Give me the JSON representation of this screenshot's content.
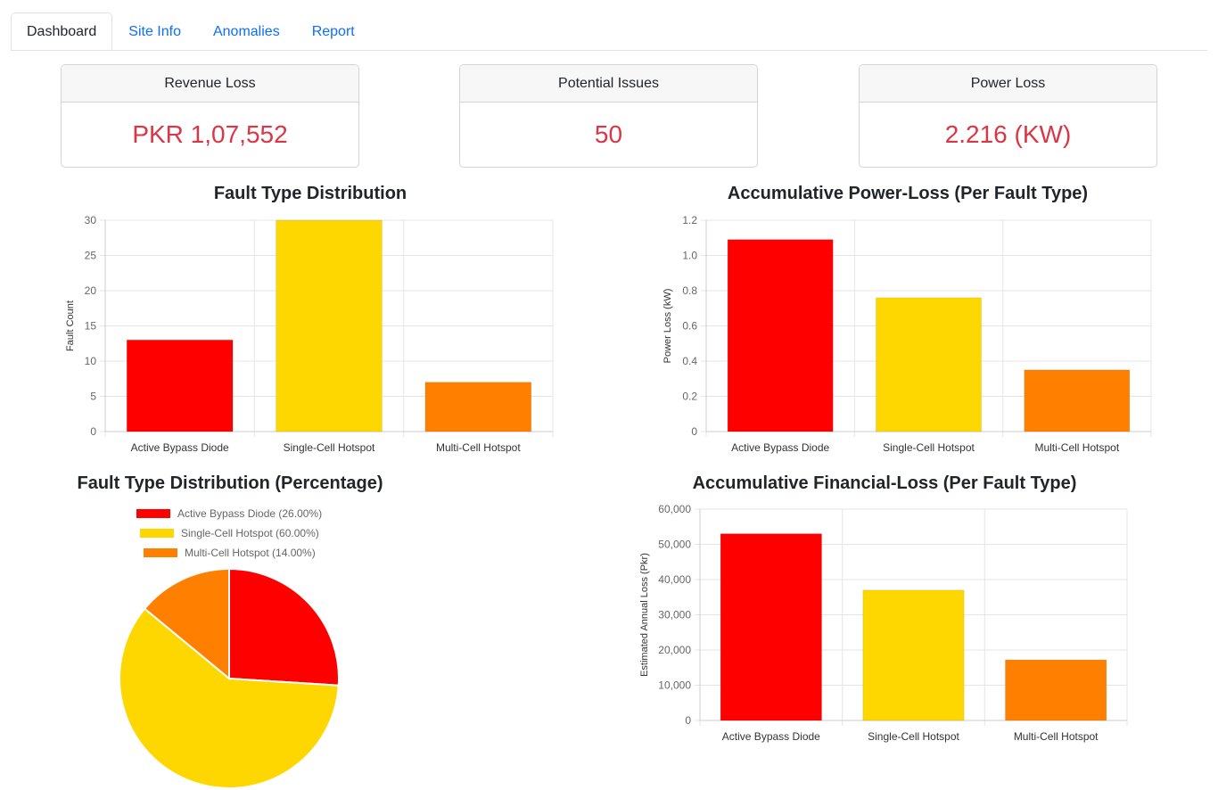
{
  "tabs": [
    {
      "label": "Dashboard",
      "active": true
    },
    {
      "label": "Site Info",
      "active": false
    },
    {
      "label": "Anomalies",
      "active": false
    },
    {
      "label": "Report",
      "active": false
    }
  ],
  "cards": {
    "revenue_loss": {
      "title": "Revenue Loss",
      "value": "PKR 1,07,552"
    },
    "potential_issues": {
      "title": "Potential Issues",
      "value": "50"
    },
    "power_loss": {
      "title": "Power Loss",
      "value": "2.216 (KW)"
    }
  },
  "colors": {
    "red": "#ff0000",
    "yellow": "#ffd700",
    "orange": "#ff8000",
    "value_text": "#dc3545",
    "link": "#0d6efd"
  },
  "chart_data": [
    {
      "id": "fault-type-distribution",
      "type": "bar",
      "title": "Fault Type Distribution",
      "ylabel": "Fault Count",
      "categories": [
        "Active Bypass Diode",
        "Single-Cell Hotspot",
        "Multi-Cell Hotspot"
      ],
      "values": [
        13,
        30,
        7
      ],
      "colors": [
        "#ff0000",
        "#ffd700",
        "#ff8000"
      ],
      "ylim": [
        0,
        30
      ],
      "yticks": [
        "0",
        "5",
        "10",
        "15",
        "20",
        "25",
        "30"
      ],
      "grid": true
    },
    {
      "id": "accumulative-power-loss",
      "type": "bar",
      "title": "Accumulative Power-Loss (Per Fault Type)",
      "ylabel": "Power Loss (kW)",
      "categories": [
        "Active Bypass Diode",
        "Single-Cell Hotspot",
        "Multi-Cell Hotspot"
      ],
      "values": [
        1.09,
        0.76,
        0.35
      ],
      "colors": [
        "#ff0000",
        "#ffd700",
        "#ff8000"
      ],
      "ylim": [
        0,
        1.2
      ],
      "yticks": [
        "0",
        "0.2",
        "0.4",
        "0.6",
        "0.8",
        "1.0",
        "1.2"
      ],
      "grid": true
    },
    {
      "id": "fault-type-percentage",
      "type": "pie",
      "title": "Fault Type Distribution (Percentage)",
      "labels": [
        "Active Bypass Diode (26.00%)",
        "Single-Cell Hotspot (60.00%)",
        "Multi-Cell Hotspot (14.00%)"
      ],
      "values": [
        26,
        60,
        14
      ],
      "colors": [
        "#ff0000",
        "#ffd700",
        "#ff8000"
      ],
      "legend": "top"
    },
    {
      "id": "accumulative-financial-loss",
      "type": "bar",
      "title": "Accumulative Financial-Loss (Per Fault Type)",
      "ylabel": "Estimated Annual Loss (Pkr)",
      "categories": [
        "Active Bypass Diode",
        "Single-Cell Hotspot",
        "Multi-Cell Hotspot"
      ],
      "values": [
        53000,
        37000,
        17200
      ],
      "colors": [
        "#ff0000",
        "#ffd700",
        "#ff8000"
      ],
      "ylim": [
        0,
        60000
      ],
      "yticks": [
        "0",
        "10,000",
        "20,000",
        "30,000",
        "40,000",
        "50,000",
        "60,000"
      ],
      "grid": true
    }
  ]
}
